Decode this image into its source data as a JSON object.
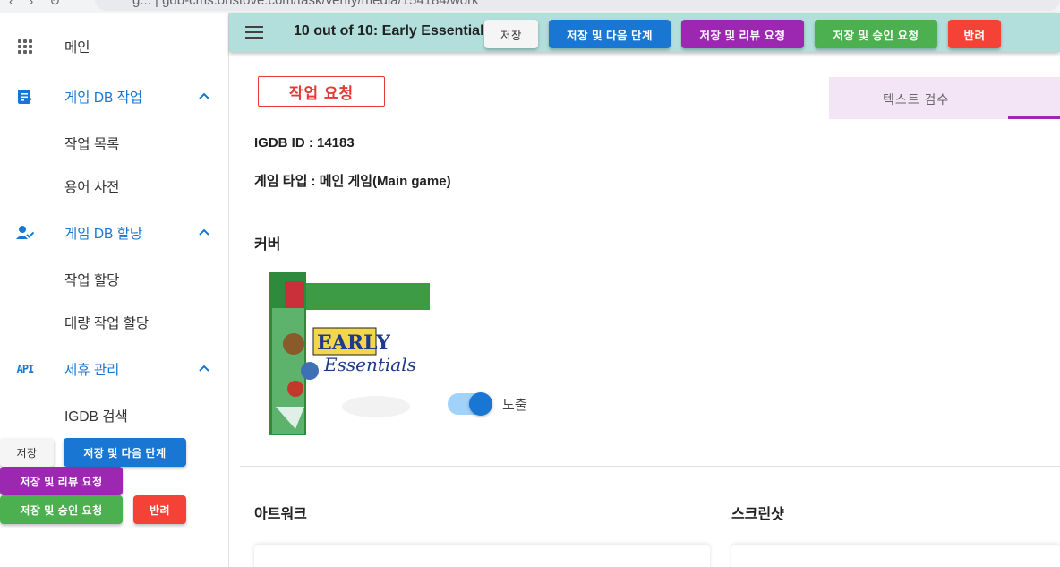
{
  "browser": {
    "url": "g... | gdb-cms.onstove.com/task/verify/media/154184/work"
  },
  "header": {
    "title": "10 out of 10: Early Essentials",
    "buttons": {
      "save": "저장",
      "save_next": "저장 및 다음 단계",
      "save_review": "저장 및 리뷰 요청",
      "save_approve": "저장 및 승인 요청",
      "reject": "반려"
    }
  },
  "sidebar": {
    "main": "메인",
    "groups": [
      {
        "label": "게임 DB 작업",
        "items": [
          "작업 목록",
          "용어 사전"
        ]
      },
      {
        "label": "게임 DB 할당",
        "items": [
          "작업 할당",
          "대량 작업 할당"
        ]
      },
      {
        "label": "제휴 관리",
        "items": [
          "IGDB 검색"
        ]
      }
    ],
    "buttons": {
      "save": "저장",
      "save_next": "저장 및 다음 단계",
      "save_review": "저장 및 리뷰 요청",
      "save_approve": "저장 및 승인 요청",
      "reject": "반려"
    }
  },
  "main": {
    "request_badge": "작업 요청",
    "tab": "텍스트 검수",
    "igdb_id": "IGDB ID : 14183",
    "game_type": "게임 타입 : 메인 게임(Main game)",
    "cover_title": "커버",
    "expose_label": "노출",
    "expose_on": true,
    "artwork_title": "아트워크",
    "screenshot_title": "스크린샷"
  },
  "colors": {
    "header_bg": "#b2dfdb",
    "primary": "#1976d2",
    "purple": "#9c27b0",
    "green": "#4caf50",
    "red": "#f44336"
  }
}
